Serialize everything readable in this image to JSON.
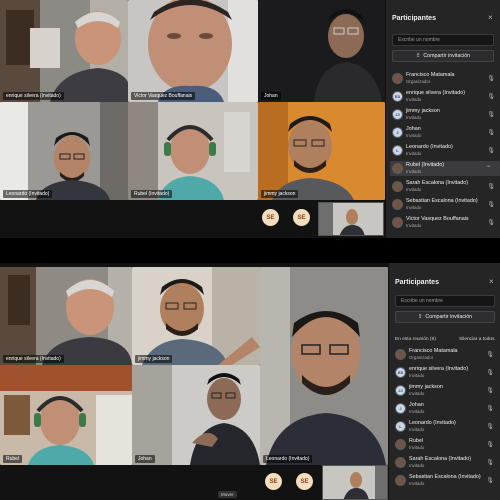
{
  "shot1": {
    "tiles": [
      {
        "label": "enrique silvera (Invitado)"
      },
      {
        "label": "Victor Vasquez Bouffanais"
      },
      {
        "label": "Johan"
      },
      {
        "label": "Leonardo (Invitado)"
      },
      {
        "label": "Rubel (Invitado)"
      },
      {
        "label": "jimmy jackson"
      }
    ],
    "avatar_initials": [
      "SE",
      "SE"
    ],
    "panel": {
      "title": "Participantes",
      "search_placeholder": "Escribe un nombre",
      "invite_label": "Compartir invitación",
      "participants": [
        {
          "name": "Francisco Matamala",
          "role": "Organizador"
        },
        {
          "name": "enrique silvera (Invitado)",
          "role": "Invitado"
        },
        {
          "name": "jimmy jackson",
          "role": "Invitado"
        },
        {
          "name": "Johan",
          "role": "Invitado"
        },
        {
          "name": "Leonardo (Invitado)",
          "role": "Invitado"
        },
        {
          "name": "Rubel (Invitado)",
          "role": "Invitado"
        },
        {
          "name": "Sarah Escalona (Invitado)",
          "role": "Invitado"
        },
        {
          "name": "Sebastian Escalona (Invitado)",
          "role": "Invitado"
        },
        {
          "name": "Victor Vasquez Bouffanais",
          "role": "Invitado"
        }
      ]
    }
  },
  "shot2": {
    "tiles": [
      {
        "label": "enrique silvera (Invitado)"
      },
      {
        "label": "jimmy jackson"
      },
      {
        "label": "Leonardo (Invitado)"
      },
      {
        "label": "Rubel"
      },
      {
        "label": "Johan"
      }
    ],
    "avatar_initials": [
      "SE",
      "SE"
    ],
    "bottom_chip": "Mover",
    "panel": {
      "title": "Participantes",
      "search_placeholder": "Escribe un nombre",
      "invite_label": "Compartir invitación",
      "section_label": "En esta reunión (9)",
      "mute_all_label": "Silenciar a todos",
      "participants": [
        {
          "name": "Francisco Matamala",
          "role": "Organizador"
        },
        {
          "name": "enrique silvera (Invitado)",
          "role": "Invitado"
        },
        {
          "name": "jimmy jackson",
          "role": "Invitado"
        },
        {
          "name": "Johan",
          "role": "Invitado"
        },
        {
          "name": "Leonardo (Invitado)",
          "role": "Invitado"
        },
        {
          "name": "Rubel",
          "role": "Invitado"
        },
        {
          "name": "Sarah Escalona (Invitado)",
          "role": "Invitado"
        },
        {
          "name": "Sebastian Escalona (Invitado)",
          "role": "Invitado"
        }
      ]
    }
  },
  "icons": {
    "close": "×",
    "mic": "🎙",
    "more": "···",
    "share": "⇪"
  }
}
